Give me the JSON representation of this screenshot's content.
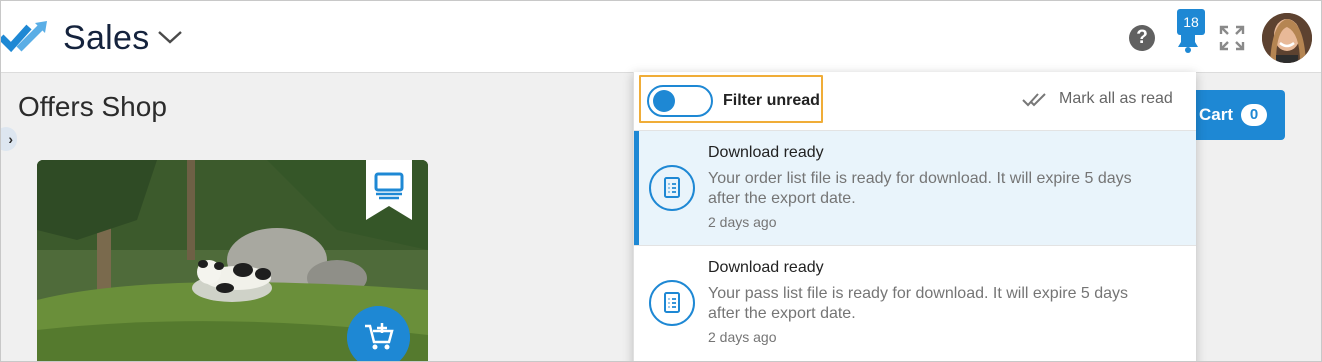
{
  "header": {
    "app_title": "Sales",
    "notification_count": "18",
    "icons": [
      "logo-icon",
      "chevron-down-icon",
      "help-icon",
      "bell-icon",
      "fullscreen-icon",
      "avatar"
    ]
  },
  "page": {
    "title": "Offers Shop",
    "sidebar_toggle": "›"
  },
  "cart": {
    "label": "Cart",
    "count": "0"
  },
  "notifications": {
    "filter_label": "Filter unread",
    "filter_on": true,
    "mark_all_label": "Mark all as read",
    "items": [
      {
        "title": "Download ready",
        "message": "Your order list file is ready for download. It will expire 5 days after the export date.",
        "time": "2 days ago",
        "unread": true
      },
      {
        "title": "Download ready",
        "message": "Your pass list file is ready for download. It will expire 5 days after the export date.",
        "time": "2 days ago",
        "unread": false
      }
    ]
  },
  "colors": {
    "accent": "#1e88d4",
    "highlight_border": "#f0ad38",
    "unread_background": "#e9f4fb"
  }
}
